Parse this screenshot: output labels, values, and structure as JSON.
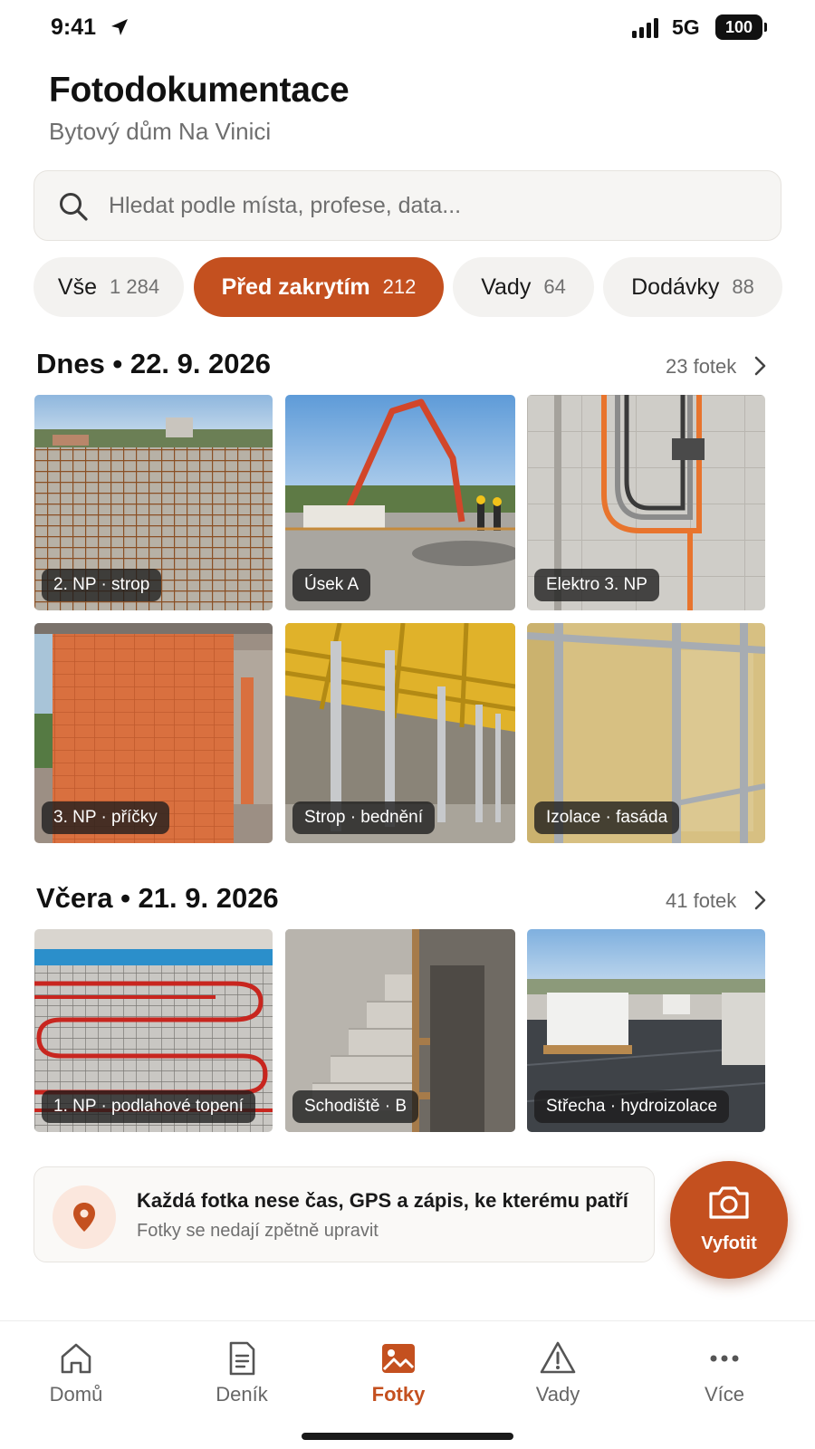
{
  "status_bar": {
    "time": "9:41",
    "network": "5G",
    "battery": "100"
  },
  "header": {
    "title": "Fotodokumentace",
    "subtitle": "Bytový dům Na Vinici"
  },
  "search": {
    "placeholder": "Hledat podle místa, profese, data..."
  },
  "filters": [
    {
      "label": "Vše",
      "count": "1 284",
      "active": false
    },
    {
      "label": "Před zakrytím",
      "count": "212",
      "active": true
    },
    {
      "label": "Vady",
      "count": "64",
      "active": false
    },
    {
      "label": "Dodávky",
      "count": "88",
      "active": false
    }
  ],
  "sections": [
    {
      "title": "Dnes • 22. 9. 2026",
      "count": "23 fotek",
      "photos": [
        {
          "label": "2. NP · strop"
        },
        {
          "label": "Úsek A"
        },
        {
          "label": "Elektro 3. NP"
        },
        {
          "label": "3. NP · příčky"
        },
        {
          "label": "Strop · bednění"
        },
        {
          "label": "Izolace · fasáda"
        }
      ]
    },
    {
      "title": "Včera • 21. 9. 2026",
      "count": "41 fotek",
      "photos": [
        {
          "label": "1. NP · podlahové topení"
        },
        {
          "label": "Schodiště · B"
        },
        {
          "label": "Střecha · hydroizolace"
        }
      ]
    }
  ],
  "info_card": {
    "headline": "Každá fotka nese čas, GPS a zápis, ke kterému patří",
    "subtext": "Fotky se nedají zpětně upravit"
  },
  "fab": {
    "label": "Vyfotit"
  },
  "tabbar": [
    {
      "label": "Domů",
      "icon": "home-icon",
      "active": false
    },
    {
      "label": "Deník",
      "icon": "document-icon",
      "active": false
    },
    {
      "label": "Fotky",
      "icon": "photo-icon",
      "active": true
    },
    {
      "label": "Vady",
      "icon": "warning-icon",
      "active": false
    },
    {
      "label": "Více",
      "icon": "more-icon",
      "active": false
    }
  ],
  "colors": {
    "accent": "#c4501f",
    "chip_bg": "#f3f2f0",
    "text": "#1a1a1a",
    "muted": "#6e6e6e"
  }
}
